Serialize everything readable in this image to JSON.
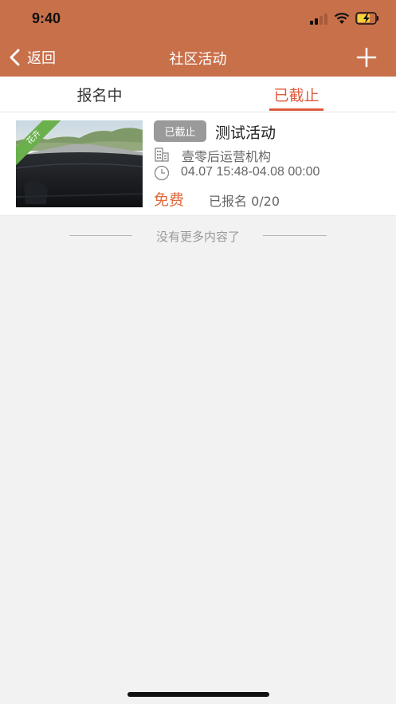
{
  "status_bar": {
    "time": "9:40"
  },
  "nav": {
    "back_label": "返回",
    "title": "社区活动"
  },
  "tabs": [
    {
      "label": "报名中",
      "active": false
    },
    {
      "label": "已截止",
      "active": true
    }
  ],
  "activity": {
    "ribbon_label": "花卉",
    "status_badge": "已截止",
    "title": "测试活动",
    "organizer": "壹零后运营机构",
    "time_range": "04.07 15:48-04.08 00:00",
    "price": "免费",
    "enrollment": "已报名 0/20"
  },
  "footer_text": "没有更多内容了",
  "colors": {
    "header": "#c8704a",
    "accent": "#e05a3c",
    "price": "#e06a3c",
    "ribbon": "#6ab04c",
    "badge": "#9a9a9a"
  },
  "icons": [
    "chevron-left-icon",
    "plus-icon",
    "building-icon",
    "clock-icon",
    "signal-icon",
    "wifi-icon",
    "battery-charging-icon"
  ]
}
